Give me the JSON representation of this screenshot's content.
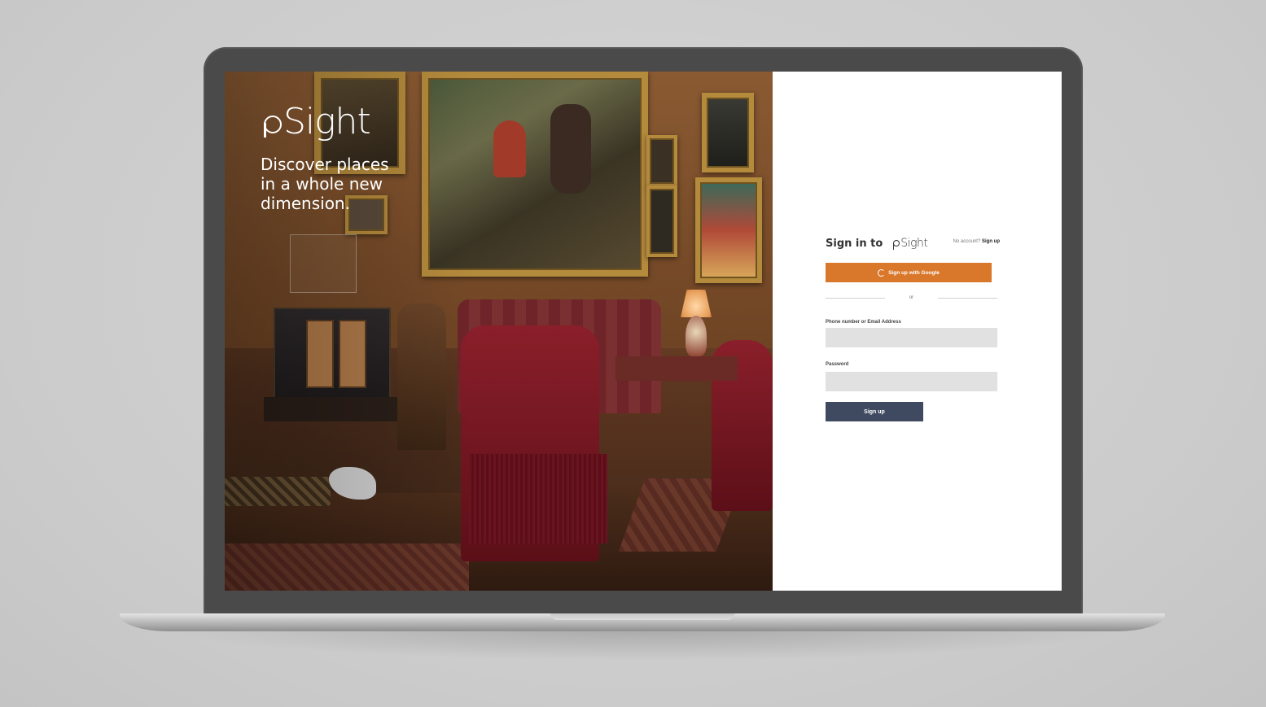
{
  "hero": {
    "brand": "Sight",
    "tagline_line1": "Discover places",
    "tagline_line2": "in a whole new",
    "tagline_line3": "dimension."
  },
  "form": {
    "title": "Sign in to",
    "brand": "Sight",
    "no_account_text": "No account?",
    "signup_link": "Sign up",
    "google_button": "Sign up with Google",
    "google_icon": "google-g-icon",
    "divider_text": "or",
    "email_label": "Phone number or Email Address",
    "email_value": "",
    "password_label": "Password",
    "password_value": "",
    "submit_button": "Sign up"
  },
  "colors": {
    "accent_orange": "#d9772a",
    "submit_navy": "#3f4a60",
    "input_bg": "#e1e1e1",
    "bezel": "#4a4a4a"
  }
}
